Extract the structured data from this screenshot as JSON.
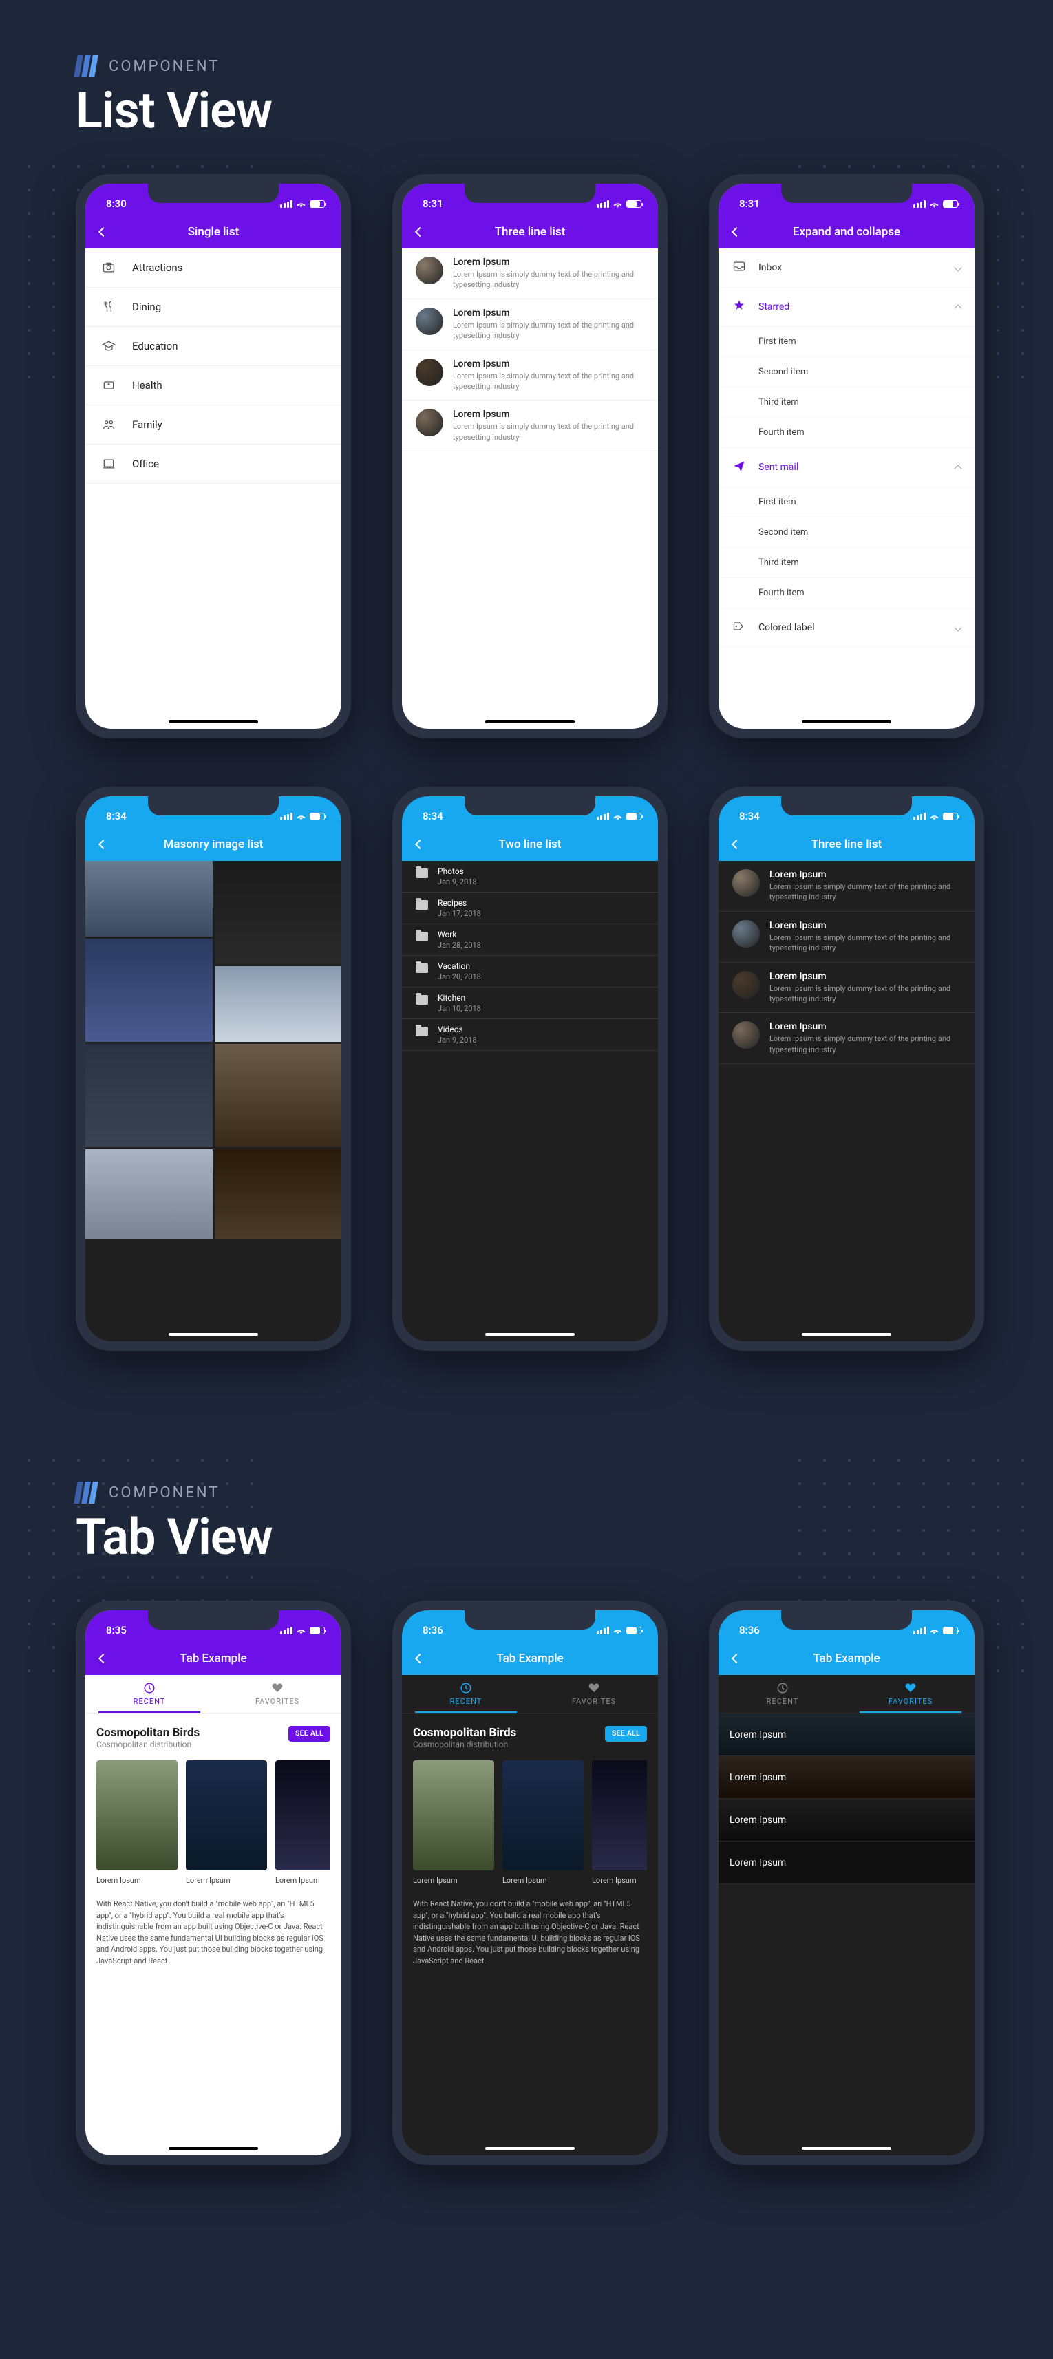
{
  "sections": [
    {
      "label": "COMPONENT",
      "title": "List View"
    },
    {
      "label": "COMPONENT",
      "title": "Tab View"
    }
  ],
  "status_time_purple": "8:30",
  "status_time_purple2": "8:31",
  "status_time_blue": "8:34",
  "status_time_tab1": "8:35",
  "status_time_tab2": "8:36",
  "screens": {
    "single_list": {
      "title": "Single list",
      "items": [
        {
          "icon": "camera",
          "label": "Attractions"
        },
        {
          "icon": "dining",
          "label": "Dining"
        },
        {
          "icon": "education",
          "label": "Education"
        },
        {
          "icon": "health",
          "label": "Health"
        },
        {
          "icon": "family",
          "label": "Family"
        },
        {
          "icon": "office",
          "label": "Office"
        }
      ]
    },
    "three_line_light": {
      "title": "Three line list",
      "items": [
        {
          "name": "Lorem Ipsum",
          "desc": "Lorem Ipsum is simply dummy text of the printing and typesetting industry"
        },
        {
          "name": "Lorem Ipsum",
          "desc": "Lorem Ipsum is simply dummy text of the printing and typesetting industry"
        },
        {
          "name": "Lorem Ipsum",
          "desc": "Lorem Ipsum is simply dummy text of the printing and typesetting industry"
        },
        {
          "name": "Lorem Ipsum",
          "desc": "Lorem Ipsum is simply dummy text of the printing and typesetting industry"
        }
      ]
    },
    "expand": {
      "title": "Expand and collapse",
      "groups": [
        {
          "icon": "inbox",
          "label": "Inbox",
          "accent": false,
          "expanded": false,
          "items": []
        },
        {
          "icon": "star",
          "label": "Starred",
          "accent": true,
          "expanded": true,
          "items": [
            "First item",
            "Second item",
            "Third item",
            "Fourth item"
          ]
        },
        {
          "icon": "send",
          "label": "Sent mail",
          "accent": true,
          "expanded": true,
          "items": [
            "First item",
            "Second item",
            "Third item",
            "Fourth item"
          ]
        },
        {
          "icon": "label",
          "label": "Colored label",
          "accent": false,
          "expanded": false,
          "items": []
        }
      ]
    },
    "masonry": {
      "title": "Masonry image list",
      "cells": [
        {
          "bg": "linear-gradient(#6b7a8f,#3a4a5f)",
          "h": 110
        },
        {
          "bg": "linear-gradient(#1a1a1a,#2a2a2a)",
          "h": 150
        },
        {
          "bg": "linear-gradient(#2a3a5f,#4a5a8f)",
          "h": 150
        },
        {
          "bg": "linear-gradient(#8a9aaf,#cad4df)",
          "h": 110
        },
        {
          "bg": "linear-gradient(#2a3244,#3a4254)",
          "h": 150
        },
        {
          "bg": "linear-gradient(#6a5a4a,#3a2a1a)",
          "h": 150
        },
        {
          "bg": "linear-gradient(#aab3c4,#7a8394)",
          "h": 130
        },
        {
          "bg": "linear-gradient(#2a1a0a,#4a3a2a)",
          "h": 130
        }
      ]
    },
    "two_line": {
      "title": "Two line list",
      "items": [
        {
          "label": "Photos",
          "date": "Jan 9, 2018"
        },
        {
          "label": "Recipes",
          "date": "Jan 17, 2018"
        },
        {
          "label": "Work",
          "date": "Jan 28, 2018"
        },
        {
          "label": "Vacation",
          "date": "Jan 20, 2018"
        },
        {
          "label": "Kitchen",
          "date": "Jan 10, 2018"
        },
        {
          "label": "Videos",
          "date": "Jan 9, 2018"
        }
      ]
    },
    "three_line_dark": {
      "title": "Three line list",
      "items": [
        {
          "name": "Lorem Ipsum",
          "desc": "Lorem Ipsum is simply dummy text of the printing and typesetting industry"
        },
        {
          "name": "Lorem Ipsum",
          "desc": "Lorem Ipsum is simply dummy text of the printing and typesetting industry"
        },
        {
          "name": "Lorem Ipsum",
          "desc": "Lorem Ipsum is simply dummy text of the printing and typesetting industry"
        },
        {
          "name": "Lorem Ipsum",
          "desc": "Lorem Ipsum is simply dummy text of the printing and typesetting industry"
        }
      ]
    },
    "tab_light": {
      "title": "Tab Example",
      "tabs": [
        {
          "label": "RECENT",
          "active": true
        },
        {
          "label": "FAVORITES",
          "active": false
        }
      ],
      "card": {
        "title": "Cosmopolitan Birds",
        "subtitle": "Cosmopolitan distribution",
        "see_all": "SEE ALL",
        "cards": [
          {
            "label": "Lorem Ipsum",
            "bg": "linear-gradient(#8a9a7a,#3a4a2a)"
          },
          {
            "label": "Lorem Ipsum",
            "bg": "linear-gradient(#1a2a4a,#0a1a2a)"
          },
          {
            "label": "Lorem Ipsum",
            "bg": "linear-gradient(#0a0a1a,#2a2a4a)"
          }
        ],
        "paragraph": "With React Native, you don't build a \"mobile web app\", an \"HTML5 app\", or a \"hybrid app\". You build a real mobile app that's indistinguishable from an app built using Objective-C or Java. React Native uses the same fundamental UI building blocks as regular iOS and Android apps. You just put those building blocks together using JavaScript and React."
      }
    },
    "tab_dark_recent": {
      "title": "Tab Example",
      "tabs": [
        {
          "label": "RECENT",
          "active": true
        },
        {
          "label": "FAVORITES",
          "active": false
        }
      ]
    },
    "tab_dark_fav": {
      "title": "Tab Example",
      "tabs": [
        {
          "label": "RECENT",
          "active": false
        },
        {
          "label": "FAVORITES",
          "active": true
        }
      ],
      "items": [
        "Lorem Ipsum",
        "Lorem Ipsum",
        "Lorem Ipsum",
        "Lorem Ipsum"
      ]
    }
  }
}
